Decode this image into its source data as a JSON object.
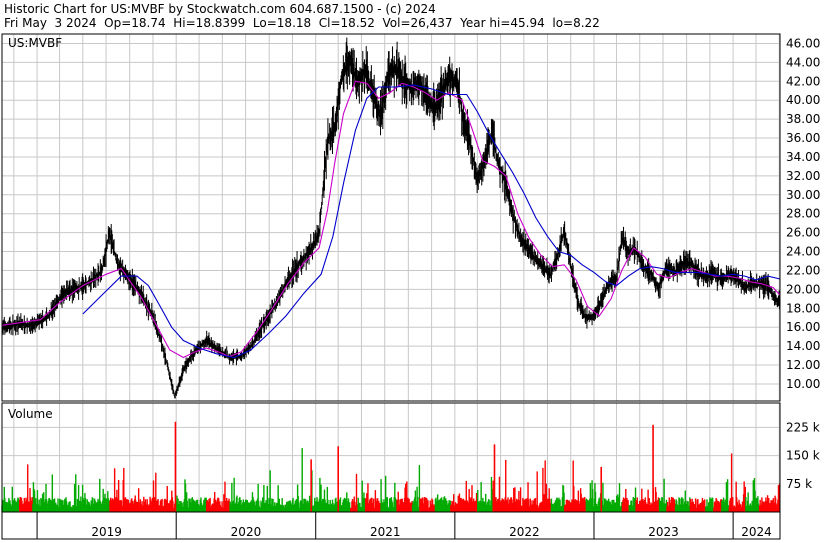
{
  "header": {
    "title_line": "Historic Chart for US:MVBF by Stockwatch.com 604.687.1500 - (c) 2024",
    "quote_line": "Fri May  3 2024  Op=18.74  Hi=18.8399  Lo=18.18  Cl=18.52  Vol=26,437  Year hi=45.94  lo=8.22"
  },
  "chart_data": {
    "type": "line",
    "symbol_label": "US:MVBF",
    "volume_label": "Volume",
    "price_axis": {
      "ylim": [
        8.2,
        47.0
      ],
      "ticks": [
        "10.00",
        "12.00",
        "14.00",
        "16.00",
        "18.00",
        "20.00",
        "22.00",
        "24.00",
        "26.00",
        "28.00",
        "30.00",
        "32.00",
        "34.00",
        "36.00",
        "38.00",
        "40.00",
        "42.00",
        "44.00",
        "46.00"
      ]
    },
    "volume_axis": {
      "ylim": [
        0,
        290000
      ],
      "ticks": [
        {
          "value": 75000,
          "label": "75 k"
        },
        {
          "value": 150000,
          "label": "150 k"
        },
        {
          "value": 225000,
          "label": "225 k"
        }
      ]
    },
    "x_range": [
      "2018-10-01",
      "2024-05-03"
    ],
    "years": [
      {
        "label": "2019",
        "start": "2019-01-01"
      },
      {
        "label": "2020",
        "start": "2020-01-01"
      },
      {
        "label": "2021",
        "start": "2021-01-01"
      },
      {
        "label": "2022",
        "start": "2022-01-01"
      },
      {
        "label": "2023",
        "start": "2023-01-01"
      },
      {
        "label": "2024",
        "start": "2024-01-01"
      }
    ],
    "grid": true,
    "colors": {
      "price": "#000000",
      "ma_short": "#cc00cc",
      "ma_long": "#0000cc",
      "volume_up": "#00aa00",
      "volume_down": "#ff0000",
      "grid": "#c8c8c8"
    },
    "series": [
      {
        "role": "price",
        "points": [
          [
            "2018-10-01",
            16.0
          ],
          [
            "2018-11-15",
            16.4
          ],
          [
            "2018-12-20",
            16.2
          ],
          [
            "2019-02-01",
            17.2
          ],
          [
            "2019-03-10",
            19.6
          ],
          [
            "2019-04-20",
            20.2
          ],
          [
            "2019-05-20",
            20.8
          ],
          [
            "2019-06-20",
            22.0
          ],
          [
            "2019-07-10",
            26.0
          ],
          [
            "2019-08-01",
            22.5
          ],
          [
            "2019-09-01",
            21.2
          ],
          [
            "2019-10-01",
            19.5
          ],
          [
            "2019-11-01",
            17.0
          ],
          [
            "2019-11-20",
            14.8
          ],
          [
            "2019-12-10",
            11.8
          ],
          [
            "2019-12-28",
            8.6
          ],
          [
            "2020-01-20",
            11.5
          ],
          [
            "2020-02-15",
            13.2
          ],
          [
            "2020-03-20",
            14.6
          ],
          [
            "2020-04-20",
            13.6
          ],
          [
            "2020-05-20",
            12.8
          ],
          [
            "2020-06-20",
            13.0
          ],
          [
            "2020-07-20",
            14.2
          ],
          [
            "2020-08-20",
            16.6
          ],
          [
            "2020-09-20",
            18.6
          ],
          [
            "2020-10-20",
            21.0
          ],
          [
            "2020-11-20",
            22.8
          ],
          [
            "2020-12-20",
            24.2
          ],
          [
            "2021-01-10",
            26.0
          ],
          [
            "2021-02-01",
            35.8
          ],
          [
            "2021-02-20",
            37.2
          ],
          [
            "2021-03-10",
            42.5
          ],
          [
            "2021-04-01",
            44.6
          ],
          [
            "2021-04-20",
            41.8
          ],
          [
            "2021-05-10",
            43.2
          ],
          [
            "2021-06-01",
            40.6
          ],
          [
            "2021-06-20",
            38.2
          ],
          [
            "2021-07-10",
            42.8
          ],
          [
            "2021-08-01",
            43.4
          ],
          [
            "2021-08-20",
            42.0
          ],
          [
            "2021-09-10",
            41.2
          ],
          [
            "2021-10-01",
            41.8
          ],
          [
            "2021-10-20",
            40.2
          ],
          [
            "2021-11-10",
            39.2
          ],
          [
            "2021-12-01",
            41.0
          ],
          [
            "2021-12-20",
            42.6
          ],
          [
            "2022-01-10",
            41.4
          ],
          [
            "2022-01-20",
            38.8
          ],
          [
            "2022-02-10",
            35.4
          ],
          [
            "2022-03-01",
            31.4
          ],
          [
            "2022-03-20",
            33.8
          ],
          [
            "2022-04-10",
            36.8
          ],
          [
            "2022-04-20",
            34.0
          ],
          [
            "2022-05-10",
            31.8
          ],
          [
            "2022-06-01",
            28.2
          ],
          [
            "2022-06-20",
            25.6
          ],
          [
            "2022-07-10",
            24.4
          ],
          [
            "2022-08-01",
            23.2
          ],
          [
            "2022-08-20",
            22.4
          ],
          [
            "2022-09-10",
            21.6
          ],
          [
            "2022-10-01",
            24.0
          ],
          [
            "2022-10-15",
            26.2
          ],
          [
            "2022-11-01",
            22.6
          ],
          [
            "2022-11-20",
            18.6
          ],
          [
            "2022-12-10",
            17.0
          ],
          [
            "2023-01-01",
            17.2
          ],
          [
            "2023-01-20",
            18.8
          ],
          [
            "2023-02-10",
            20.6
          ],
          [
            "2023-03-01",
            21.2
          ],
          [
            "2023-03-15",
            25.4
          ],
          [
            "2023-04-01",
            24.0
          ],
          [
            "2023-04-20",
            24.2
          ],
          [
            "2023-05-10",
            22.4
          ],
          [
            "2023-06-01",
            21.6
          ],
          [
            "2023-06-20",
            20.2
          ],
          [
            "2023-07-10",
            22.4
          ],
          [
            "2023-08-01",
            21.8
          ],
          [
            "2023-08-20",
            22.6
          ],
          [
            "2023-09-10",
            22.8
          ],
          [
            "2023-10-01",
            21.8
          ],
          [
            "2023-10-20",
            21.2
          ],
          [
            "2023-11-10",
            21.8
          ],
          [
            "2023-12-01",
            21.0
          ],
          [
            "2023-12-20",
            21.6
          ],
          [
            "2024-01-10",
            21.2
          ],
          [
            "2024-02-01",
            20.2
          ],
          [
            "2024-02-20",
            20.6
          ],
          [
            "2024-03-10",
            20.6
          ],
          [
            "2024-04-01",
            20.4
          ],
          [
            "2024-04-20",
            19.0
          ],
          [
            "2024-05-03",
            18.52
          ]
        ]
      },
      {
        "role": "ma_short",
        "points": [
          [
            "2018-10-01",
            16.2
          ],
          [
            "2019-01-10",
            16.8
          ],
          [
            "2019-03-01",
            18.6
          ],
          [
            "2019-05-01",
            20.4
          ],
          [
            "2019-07-01",
            21.6
          ],
          [
            "2019-08-10",
            22.2
          ],
          [
            "2019-10-01",
            19.2
          ],
          [
            "2019-11-10",
            16.2
          ],
          [
            "2019-12-15",
            13.6
          ],
          [
            "2020-01-20",
            12.8
          ],
          [
            "2020-02-20",
            13.4
          ],
          [
            "2020-03-20",
            13.8
          ],
          [
            "2020-04-20",
            13.4
          ],
          [
            "2020-05-20",
            12.9
          ],
          [
            "2020-06-20",
            13.4
          ],
          [
            "2020-08-01",
            15.6
          ],
          [
            "2020-09-10",
            18.0
          ],
          [
            "2020-10-20",
            20.6
          ],
          [
            "2020-12-01",
            22.8
          ],
          [
            "2021-01-10",
            24.4
          ],
          [
            "2021-02-01",
            28.4
          ],
          [
            "2021-02-20",
            33.4
          ],
          [
            "2021-03-15",
            38.6
          ],
          [
            "2021-04-15",
            42.0
          ],
          [
            "2021-05-15",
            41.8
          ],
          [
            "2021-06-15",
            40.2
          ],
          [
            "2021-07-15",
            40.8
          ],
          [
            "2021-08-15",
            41.8
          ],
          [
            "2021-09-15",
            41.4
          ],
          [
            "2021-10-15",
            40.8
          ],
          [
            "2021-11-15",
            40.0
          ],
          [
            "2021-12-15",
            40.8
          ],
          [
            "2022-01-20",
            40.0
          ],
          [
            "2022-02-15",
            37.0
          ],
          [
            "2022-03-15",
            33.6
          ],
          [
            "2022-04-15",
            33.0
          ],
          [
            "2022-05-15",
            32.0
          ],
          [
            "2022-06-15",
            28.0
          ],
          [
            "2022-07-15",
            25.4
          ],
          [
            "2022-08-15",
            23.6
          ],
          [
            "2022-09-15",
            22.4
          ],
          [
            "2022-10-15",
            22.6
          ],
          [
            "2022-11-15",
            21.0
          ],
          [
            "2022-12-15",
            18.2
          ],
          [
            "2023-01-15",
            17.2
          ],
          [
            "2023-02-15",
            19.0
          ],
          [
            "2023-03-15",
            22.0
          ],
          [
            "2023-04-15",
            24.4
          ],
          [
            "2023-05-15",
            23.4
          ],
          [
            "2023-06-15",
            21.6
          ],
          [
            "2023-07-15",
            21.2
          ],
          [
            "2023-08-15",
            21.8
          ],
          [
            "2023-09-15",
            22.2
          ],
          [
            "2023-10-15",
            21.8
          ],
          [
            "2023-11-15",
            21.4
          ],
          [
            "2023-12-15",
            21.4
          ],
          [
            "2024-01-15",
            21.2
          ],
          [
            "2024-02-15",
            20.8
          ],
          [
            "2024-03-15",
            20.6
          ],
          [
            "2024-04-15",
            20.2
          ],
          [
            "2024-05-03",
            19.4
          ]
        ]
      },
      {
        "role": "ma_long",
        "points": [
          [
            "2019-05-01",
            17.4
          ],
          [
            "2019-06-20",
            19.4
          ],
          [
            "2019-08-10",
            21.4
          ],
          [
            "2019-09-20",
            21.4
          ],
          [
            "2019-10-20",
            20.4
          ],
          [
            "2019-11-20",
            18.2
          ],
          [
            "2019-12-20",
            16.0
          ],
          [
            "2020-01-20",
            14.6
          ],
          [
            "2020-03-01",
            13.8
          ],
          [
            "2020-04-15",
            13.2
          ],
          [
            "2020-06-01",
            12.8
          ],
          [
            "2020-07-15",
            13.6
          ],
          [
            "2020-09-01",
            15.4
          ],
          [
            "2020-10-15",
            17.2
          ],
          [
            "2020-12-01",
            19.6
          ],
          [
            "2021-01-15",
            21.6
          ],
          [
            "2021-02-15",
            25.6
          ],
          [
            "2021-03-15",
            31.2
          ],
          [
            "2021-04-15",
            36.8
          ],
          [
            "2021-05-15",
            40.2
          ],
          [
            "2021-06-15",
            41.4
          ],
          [
            "2021-08-01",
            41.4
          ],
          [
            "2021-09-15",
            41.6
          ],
          [
            "2021-11-01",
            41.2
          ],
          [
            "2021-12-15",
            40.6
          ],
          [
            "2022-02-01",
            40.6
          ],
          [
            "2022-03-01",
            38.8
          ],
          [
            "2022-04-01",
            36.4
          ],
          [
            "2022-05-01",
            34.4
          ],
          [
            "2022-06-01",
            32.4
          ],
          [
            "2022-07-01",
            30.2
          ],
          [
            "2022-08-01",
            27.6
          ],
          [
            "2022-09-01",
            25.6
          ],
          [
            "2022-10-01",
            24.0
          ],
          [
            "2022-11-01",
            23.6
          ],
          [
            "2022-12-01",
            22.6
          ],
          [
            "2023-01-01",
            21.8
          ],
          [
            "2023-02-01",
            20.8
          ],
          [
            "2023-03-01",
            20.4
          ],
          [
            "2023-04-01",
            21.4
          ],
          [
            "2023-05-01",
            22.2
          ],
          [
            "2023-06-01",
            22.4
          ],
          [
            "2023-07-01",
            22.2
          ],
          [
            "2023-08-01",
            21.8
          ],
          [
            "2023-09-01",
            21.8
          ],
          [
            "2023-10-01",
            21.8
          ],
          [
            "2023-11-01",
            21.6
          ],
          [
            "2023-12-01",
            21.4
          ],
          [
            "2024-01-01",
            21.6
          ],
          [
            "2024-02-01",
            21.4
          ],
          [
            "2024-03-01",
            21.0
          ],
          [
            "2024-04-01",
            21.4
          ],
          [
            "2024-05-03",
            21.1
          ]
        ]
      }
    ]
  }
}
